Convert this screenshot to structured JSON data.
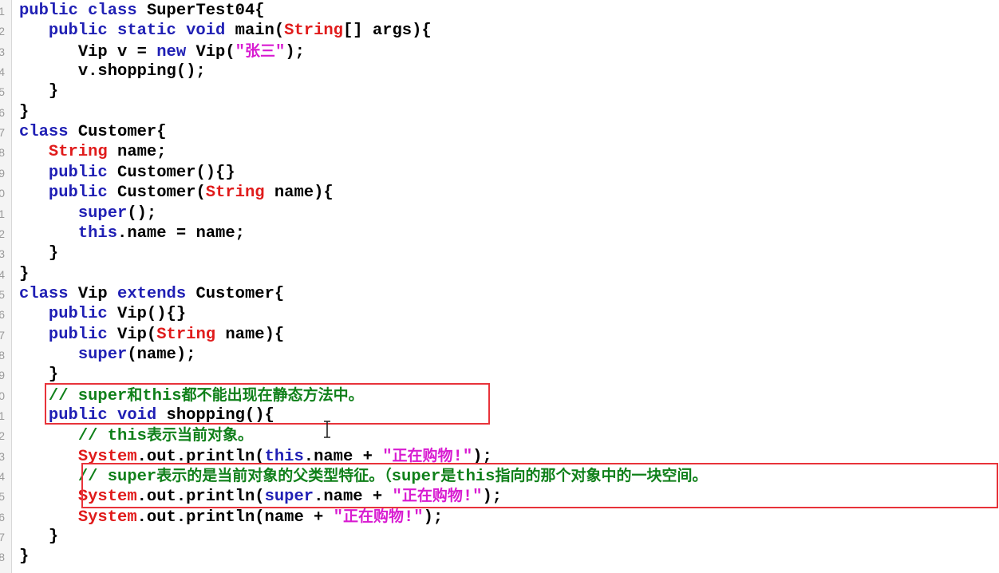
{
  "editor": {
    "language": "java",
    "line_number_digits": [
      "1",
      "2",
      "3",
      "4",
      "5",
      "6",
      "7",
      "8",
      "9",
      "0",
      "1",
      "2",
      "3",
      "4",
      "5",
      "6",
      "7",
      "8",
      "9",
      "0",
      "1",
      "2",
      "3",
      "4",
      "5",
      "6",
      "7",
      "8"
    ],
    "lines": [
      {
        "indent": "",
        "tokens": [
          {
            "t": "kw",
            "v": "public class "
          },
          {
            "t": "plain",
            "v": "SuperTest04{"
          }
        ]
      },
      {
        "indent": "   ",
        "tokens": [
          {
            "t": "kw",
            "v": "public static void "
          },
          {
            "t": "plain",
            "v": "main("
          },
          {
            "t": "type",
            "v": "String"
          },
          {
            "t": "plain",
            "v": "[] args){"
          }
        ]
      },
      {
        "indent": "      ",
        "tokens": [
          {
            "t": "plain",
            "v": "Vip v = "
          },
          {
            "t": "kw",
            "v": "new "
          },
          {
            "t": "plain",
            "v": "Vip("
          },
          {
            "t": "str",
            "v": "\"张三\""
          },
          {
            "t": "plain",
            "v": ");"
          }
        ]
      },
      {
        "indent": "      ",
        "tokens": [
          {
            "t": "plain",
            "v": "v.shopping();"
          }
        ]
      },
      {
        "indent": "   ",
        "tokens": [
          {
            "t": "plain",
            "v": "}"
          }
        ]
      },
      {
        "indent": "",
        "tokens": [
          {
            "t": "plain",
            "v": "}"
          }
        ]
      },
      {
        "indent": "",
        "tokens": [
          {
            "t": "kw",
            "v": "class "
          },
          {
            "t": "plain",
            "v": "Customer{"
          }
        ]
      },
      {
        "indent": "   ",
        "tokens": [
          {
            "t": "type",
            "v": "String "
          },
          {
            "t": "plain",
            "v": "name;"
          }
        ]
      },
      {
        "indent": "   ",
        "tokens": [
          {
            "t": "kw",
            "v": "public "
          },
          {
            "t": "plain",
            "v": "Customer(){}"
          }
        ]
      },
      {
        "indent": "   ",
        "tokens": [
          {
            "t": "kw",
            "v": "public "
          },
          {
            "t": "plain",
            "v": "Customer("
          },
          {
            "t": "type",
            "v": "String "
          },
          {
            "t": "plain",
            "v": "name){"
          }
        ]
      },
      {
        "indent": "      ",
        "tokens": [
          {
            "t": "kw",
            "v": "super"
          },
          {
            "t": "plain",
            "v": "();"
          }
        ]
      },
      {
        "indent": "      ",
        "tokens": [
          {
            "t": "kw",
            "v": "this"
          },
          {
            "t": "plain",
            "v": ".name = name;"
          }
        ]
      },
      {
        "indent": "   ",
        "tokens": [
          {
            "t": "plain",
            "v": "}"
          }
        ]
      },
      {
        "indent": "",
        "tokens": [
          {
            "t": "plain",
            "v": "}"
          }
        ]
      },
      {
        "indent": "",
        "tokens": [
          {
            "t": "kw",
            "v": "class "
          },
          {
            "t": "plain",
            "v": "Vip "
          },
          {
            "t": "kw",
            "v": "extends "
          },
          {
            "t": "plain",
            "v": "Customer{"
          }
        ]
      },
      {
        "indent": "   ",
        "tokens": [
          {
            "t": "kw",
            "v": "public "
          },
          {
            "t": "plain",
            "v": "Vip(){}"
          }
        ]
      },
      {
        "indent": "   ",
        "tokens": [
          {
            "t": "kw",
            "v": "public "
          },
          {
            "t": "plain",
            "v": "Vip("
          },
          {
            "t": "type",
            "v": "String "
          },
          {
            "t": "plain",
            "v": "name){"
          }
        ]
      },
      {
        "indent": "      ",
        "tokens": [
          {
            "t": "kw",
            "v": "super"
          },
          {
            "t": "plain",
            "v": "(name);"
          }
        ]
      },
      {
        "indent": "   ",
        "tokens": [
          {
            "t": "plain",
            "v": "}"
          }
        ]
      },
      {
        "indent": "   ",
        "tokens": [
          {
            "t": "com",
            "v": "// super和this都不能出现在静态方法中。"
          }
        ]
      },
      {
        "indent": "   ",
        "tokens": [
          {
            "t": "kw",
            "v": "public void "
          },
          {
            "t": "plain",
            "v": "shopping(){"
          }
        ]
      },
      {
        "indent": "      ",
        "tokens": [
          {
            "t": "com",
            "v": "// this表示当前对象。"
          }
        ]
      },
      {
        "indent": "      ",
        "tokens": [
          {
            "t": "type",
            "v": "System"
          },
          {
            "t": "plain",
            "v": ".out.println("
          },
          {
            "t": "kw",
            "v": "this"
          },
          {
            "t": "plain",
            "v": ".name + "
          },
          {
            "t": "str",
            "v": "\"正在购物!\""
          },
          {
            "t": "plain",
            "v": ");"
          }
        ]
      },
      {
        "indent": "      ",
        "tokens": [
          {
            "t": "com",
            "v": "// super表示的是当前对象的父类型特征。（super是this指向的那个对象中的一块空间。"
          }
        ]
      },
      {
        "indent": "      ",
        "tokens": [
          {
            "t": "type",
            "v": "System"
          },
          {
            "t": "plain",
            "v": ".out.println("
          },
          {
            "t": "kw",
            "v": "super"
          },
          {
            "t": "plain",
            "v": ".name + "
          },
          {
            "t": "str",
            "v": "\"正在购物!\""
          },
          {
            "t": "plain",
            "v": ");"
          }
        ]
      },
      {
        "indent": "      ",
        "tokens": [
          {
            "t": "type",
            "v": "System"
          },
          {
            "t": "plain",
            "v": ".out.println(name + "
          },
          {
            "t": "str",
            "v": "\"正在购物!\""
          },
          {
            "t": "plain",
            "v": ");"
          }
        ]
      },
      {
        "indent": "   ",
        "tokens": [
          {
            "t": "plain",
            "v": "}"
          }
        ]
      },
      {
        "indent": "",
        "tokens": [
          {
            "t": "plain",
            "v": "}"
          }
        ]
      }
    ]
  },
  "colors": {
    "keyword": "#1f1fb4",
    "type": "#e01b1b",
    "string": "#d81bd1",
    "comment": "#10801a",
    "highlight_border": "#e8333a"
  }
}
